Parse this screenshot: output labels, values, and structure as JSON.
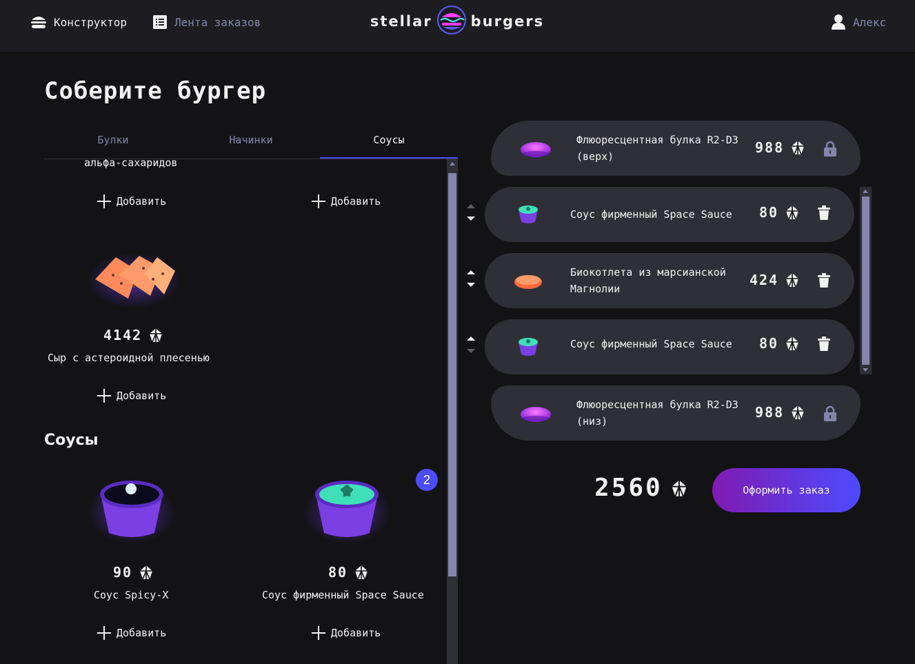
{
  "header": {
    "constructor_label": "Конструктор",
    "feed_label": "Лента заказов",
    "logo_left": "stellar",
    "logo_right": "burgers",
    "profile_label": "Алекс"
  },
  "page": {
    "title": "Соберите бургер"
  },
  "tabs": [
    {
      "label": "Булки",
      "active": false
    },
    {
      "label": "Начинки",
      "active": false
    },
    {
      "label": "Соусы",
      "active": true
    }
  ],
  "ingredients": {
    "partial_name": "альфа-сахаридов",
    "add_label": "Добавить",
    "cheese": {
      "price": "4142",
      "name": "Сыр с астероидной плесенью"
    },
    "section_sauces": "Соусы",
    "sauces": [
      {
        "price": "90",
        "name": "Соус Spicy-X",
        "count": null
      },
      {
        "price": "80",
        "name": "Соус фирменный Space Sauce",
        "count": "2"
      }
    ]
  },
  "constructor": {
    "bun_top": {
      "name": "Флюоресцентная булка R2-D3 (верх)",
      "price": "988"
    },
    "items": [
      {
        "name": "Соус фирменный Space Sauce",
        "price": "80"
      },
      {
        "name": "Биокотлета из марсианской Магнолии",
        "price": "424"
      },
      {
        "name": "Соус фирменный Space Sauce",
        "price": "80"
      }
    ],
    "bun_bottom": {
      "name": "Флюоресцентная булка R2-D3 (низ)",
      "price": "988"
    },
    "total": "2560",
    "order_button": "Оформить заказ"
  },
  "colors": {
    "accent": "#4C4CFF",
    "background": "#131316",
    "panel": "#2F2F37",
    "header": "#1C1C21"
  }
}
